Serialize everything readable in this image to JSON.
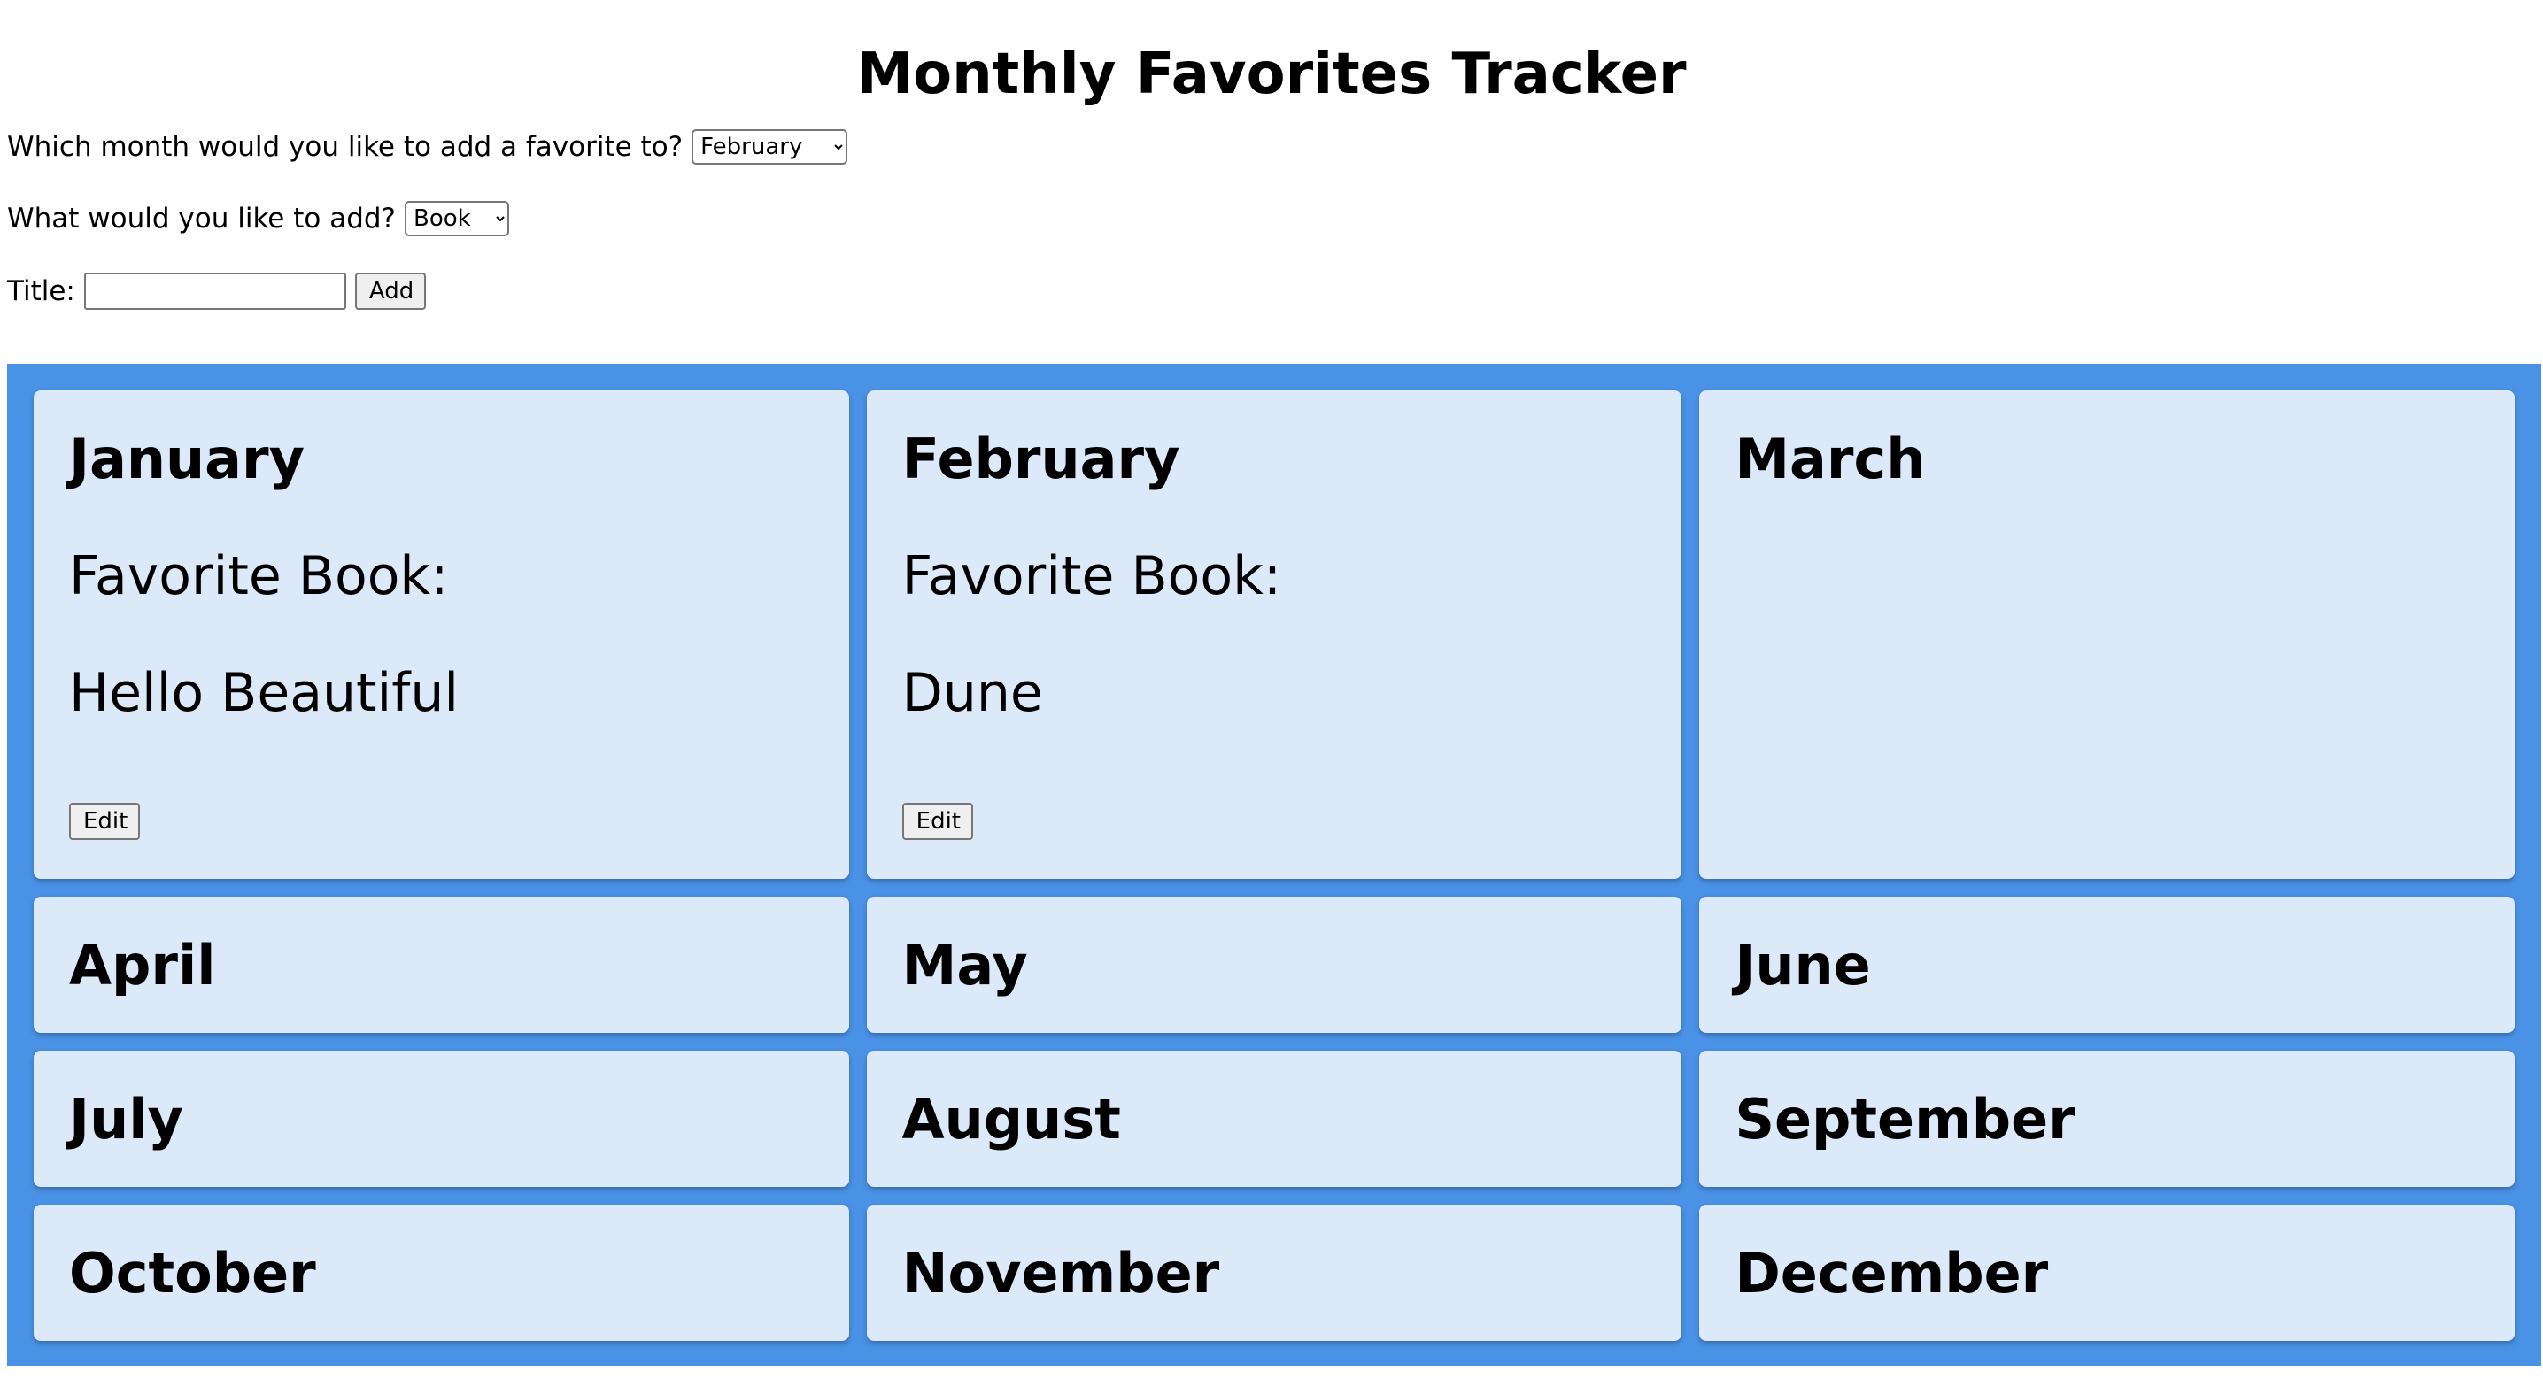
{
  "header": {
    "title": "Monthly Favorites Tracker"
  },
  "form": {
    "month_prompt": "Which month would you like to add a favorite to?",
    "month_selected": "February",
    "type_prompt": "What would you like to add?",
    "type_selected": "Book",
    "title_label": "Title:",
    "title_value": "",
    "add_label": "Add"
  },
  "months": [
    {
      "name": "January",
      "favorite_label": "Favorite Book:",
      "favorite_title": "Hello Beautiful",
      "edit_label": "Edit"
    },
    {
      "name": "February",
      "favorite_label": "Favorite Book:",
      "favorite_title": "Dune",
      "edit_label": "Edit"
    },
    {
      "name": "March"
    },
    {
      "name": "April"
    },
    {
      "name": "May"
    },
    {
      "name": "June"
    },
    {
      "name": "July"
    },
    {
      "name": "August"
    },
    {
      "name": "September"
    },
    {
      "name": "October"
    },
    {
      "name": "November"
    },
    {
      "name": "December"
    }
  ],
  "colors": {
    "grid_background": "#4a92e6",
    "card_background": "#dbe9f9"
  }
}
